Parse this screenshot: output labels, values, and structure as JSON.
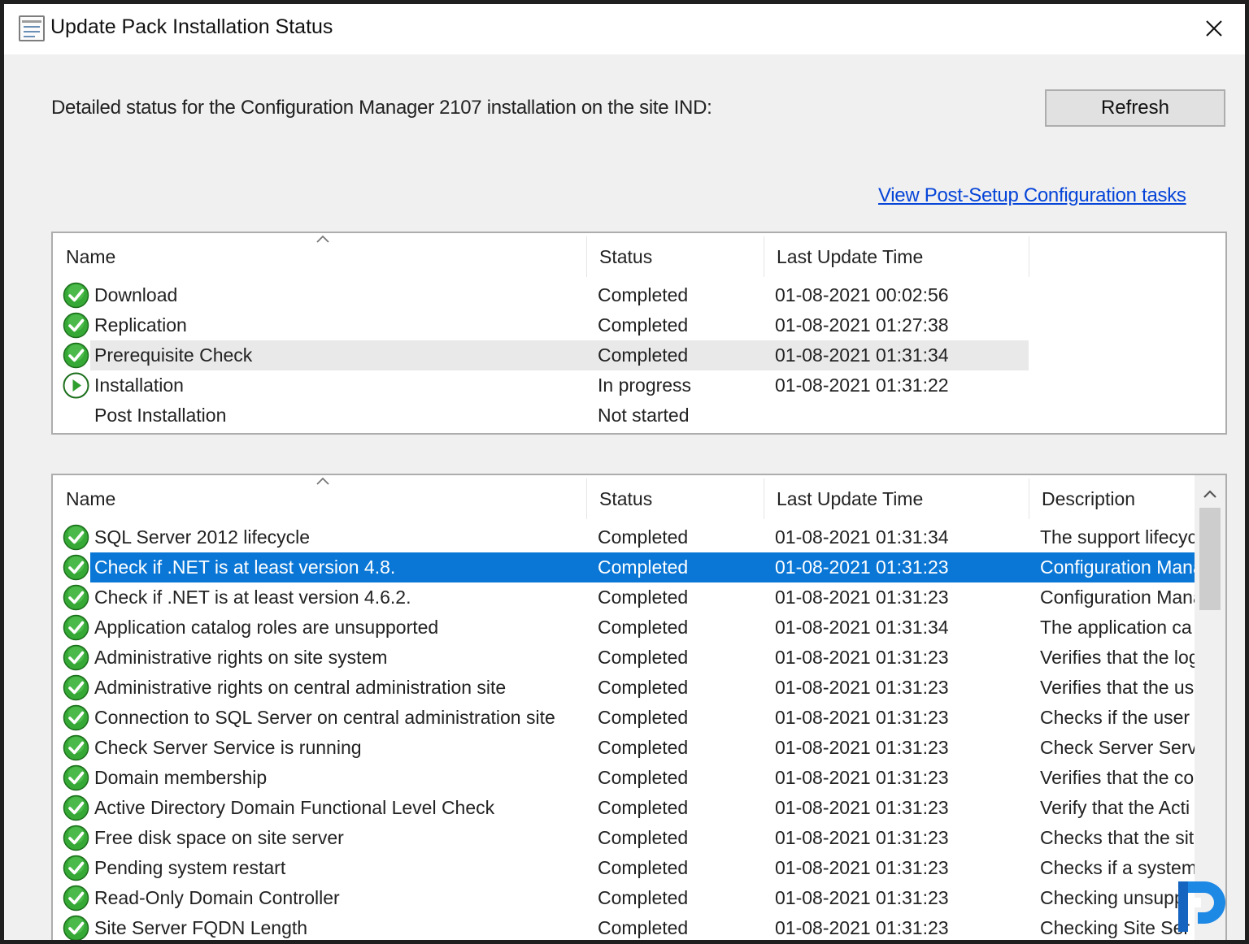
{
  "window": {
    "title": "Update Pack Installation Status"
  },
  "status_text": "Detailed status for the Configuration Manager 2107 installation on the site IND:",
  "refresh_label": "Refresh",
  "post_setup_link": "View Post-Setup Configuration tasks",
  "phases": {
    "columns": [
      "Name",
      "Status",
      "Last Update Time"
    ],
    "rows": [
      {
        "icon": "check-icon",
        "name": "Download",
        "status": "Completed",
        "time": "01-08-2021 00:02:56"
      },
      {
        "icon": "check-icon",
        "name": "Replication",
        "status": "Completed",
        "time": "01-08-2021 01:27:38"
      },
      {
        "icon": "check-icon",
        "name": "Prerequisite Check",
        "status": "Completed",
        "time": "01-08-2021 01:31:34"
      },
      {
        "icon": "in-progress-icon",
        "name": "Installation",
        "status": "In progress",
        "time": "01-08-2021 01:31:22"
      },
      {
        "icon": "",
        "name": "Post Installation",
        "status": "Not started",
        "time": ""
      }
    ]
  },
  "checks": {
    "columns": [
      "Name",
      "Status",
      "Last Update Time",
      "Description"
    ],
    "rows": [
      {
        "icon": "check-icon",
        "name": "SQL Server 2012 lifecycle",
        "status": "Completed",
        "time": "01-08-2021 01:31:34",
        "description": "The support lifecyc"
      },
      {
        "icon": "check-icon",
        "name": "Check if .NET is at least version 4.8.",
        "status": "Completed",
        "time": "01-08-2021 01:31:23",
        "description": "Configuration Mana"
      },
      {
        "icon": "check-icon",
        "name": "Check if .NET is at least version 4.6.2.",
        "status": "Completed",
        "time": "01-08-2021 01:31:23",
        "description": "Configuration Mana"
      },
      {
        "icon": "check-icon",
        "name": "Application catalog roles are unsupported",
        "status": "Completed",
        "time": "01-08-2021 01:31:34",
        "description": "The application ca"
      },
      {
        "icon": "check-icon",
        "name": "Administrative rights on site system",
        "status": "Completed",
        "time": "01-08-2021 01:31:23",
        "description": "Verifies that the log"
      },
      {
        "icon": "check-icon",
        "name": "Administrative rights on central administration site",
        "status": "Completed",
        "time": "01-08-2021 01:31:23",
        "description": "Verifies that the us"
      },
      {
        "icon": "check-icon",
        "name": "Connection to SQL Server on central administration site",
        "status": "Completed",
        "time": "01-08-2021 01:31:23",
        "description": "Checks if the user"
      },
      {
        "icon": "check-icon",
        "name": "Check Server Service is running",
        "status": "Completed",
        "time": "01-08-2021 01:31:23",
        "description": "Check Server Serv"
      },
      {
        "icon": "check-icon",
        "name": "Domain membership",
        "status": "Completed",
        "time": "01-08-2021 01:31:23",
        "description": "Verifies that the co"
      },
      {
        "icon": "check-icon",
        "name": "Active Directory Domain Functional Level Check",
        "status": "Completed",
        "time": "01-08-2021 01:31:23",
        "description": "Verify that the Acti"
      },
      {
        "icon": "check-icon",
        "name": "Free disk space on site server",
        "status": "Completed",
        "time": "01-08-2021 01:31:23",
        "description": "Checks that the sit"
      },
      {
        "icon": "check-icon",
        "name": "Pending system restart",
        "status": "Completed",
        "time": "01-08-2021 01:31:23",
        "description": "Checks if a system"
      },
      {
        "icon": "check-icon",
        "name": "Read-Only Domain Controller",
        "status": "Completed",
        "time": "01-08-2021 01:31:23",
        "description": "Checking unsupp"
      },
      {
        "icon": "check-icon",
        "name": "Site Server FQDN Length",
        "status": "Completed",
        "time": "01-08-2021 01:31:23",
        "description": "Checking Site Ser"
      }
    ]
  },
  "colors": {
    "selection": "#0a77d6",
    "link": "#0645d8",
    "check_green": "#2e9e2e",
    "watermark_blue": "#1565c0"
  }
}
